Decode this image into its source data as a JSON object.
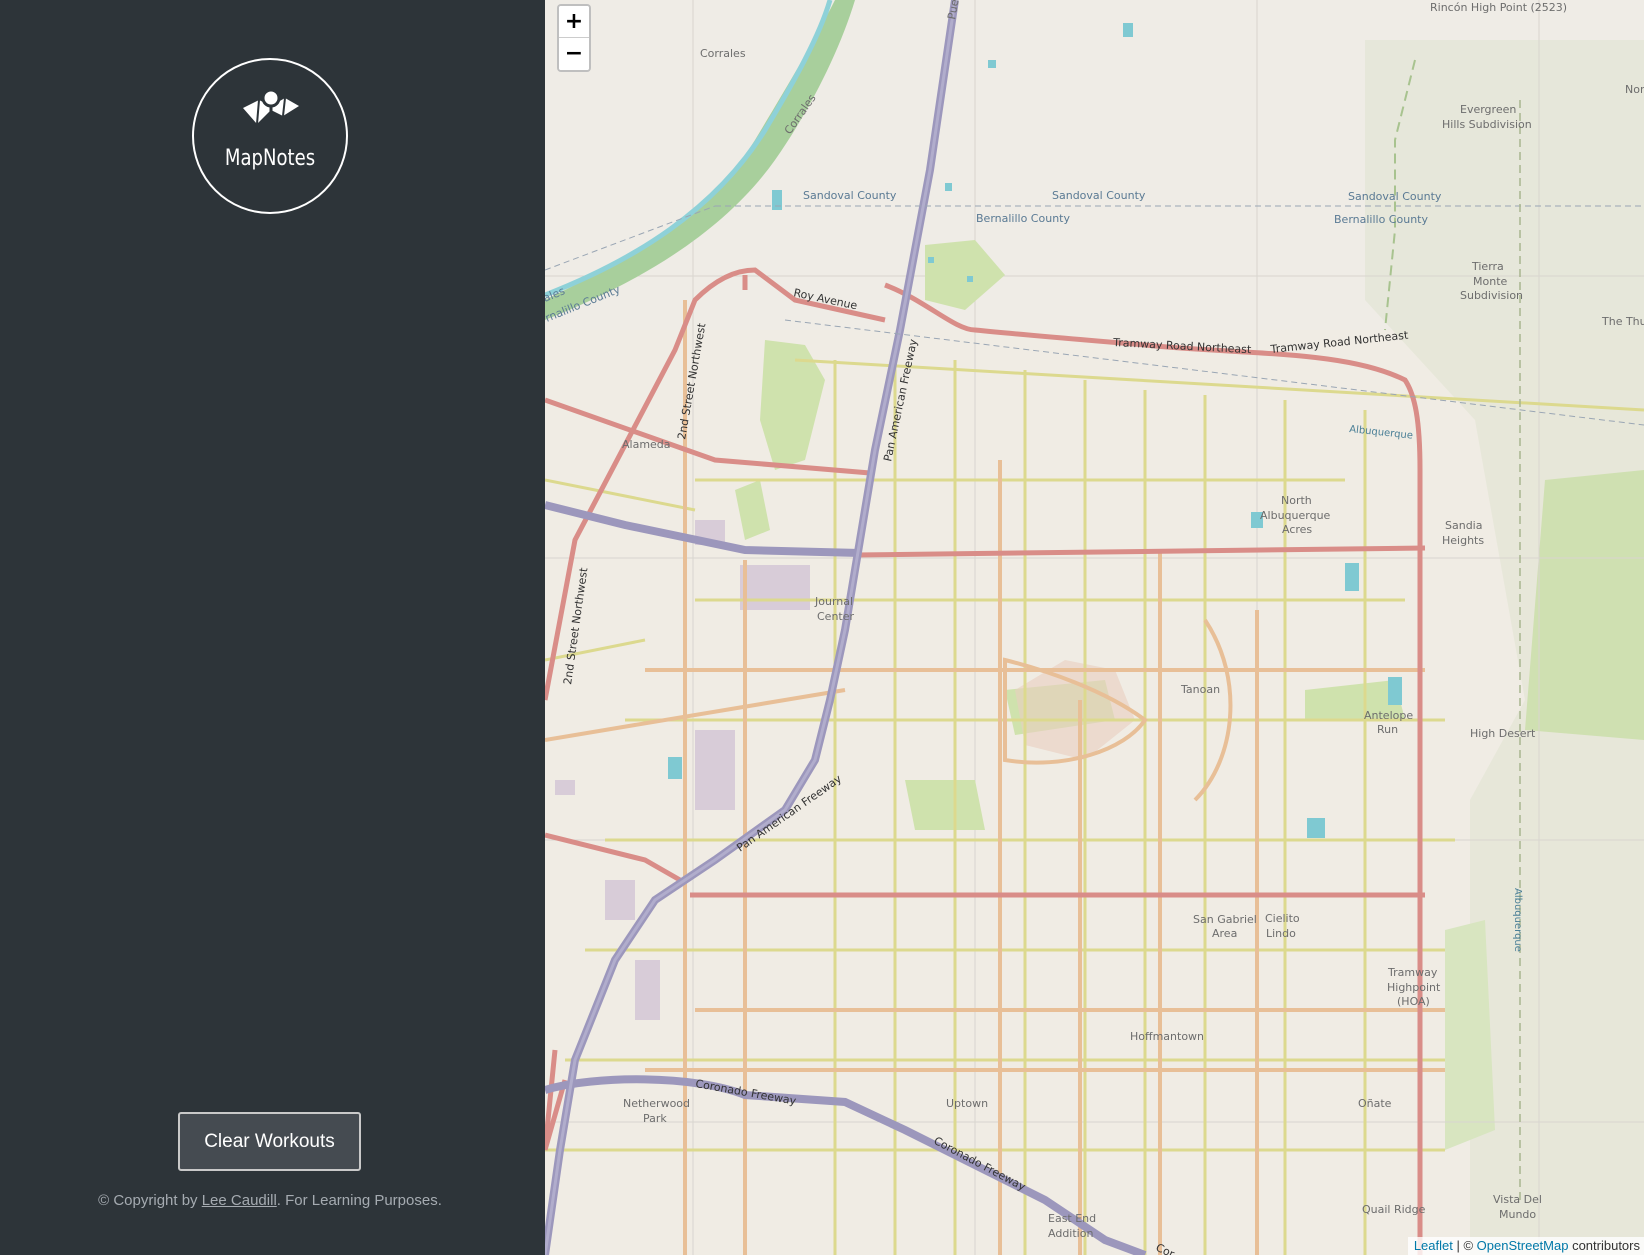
{
  "app": {
    "logo_text": "MapNotes",
    "logo_icon": "map-pin-icon"
  },
  "sidebar": {
    "clear_button_label": "Clear Workouts",
    "copyright_prefix": "© Copyright by ",
    "copyright_author": "Lee Caudill",
    "copyright_suffix": ". For Learning Purposes."
  },
  "map_controls": {
    "zoom_in": "+",
    "zoom_out": "−"
  },
  "attribution": {
    "leaflet": "Leaflet",
    "separator": " | © ",
    "osm": "OpenStreetMap",
    "suffix": " contributors"
  },
  "map_labels": {
    "corrales": "Corrales",
    "corrales_road": "Corrales",
    "sandoval_county": "Sandoval County",
    "bernalillo_county": "Bernalillo County",
    "bernalillo_county_left": "rnalillo County",
    "rincon": "Rincón High Point (2523)",
    "evergreen": [
      "Evergreen",
      "Hills Subdivision"
    ],
    "tierra": [
      "Tierra",
      "Monte",
      "Subdivision"
    ],
    "the_thu": "The Thu",
    "nort": "Nort",
    "roy_avenue": "Roy Avenue",
    "tramway_road": "Tramway Road Northeast",
    "second_street": "2nd Street Northwest",
    "alameda": "Alameda",
    "pan_american": "Pan American Freeway",
    "albuquerque": "Albuquerque",
    "north_albuquerque": [
      "North",
      "Albuquerque",
      "Acres"
    ],
    "sandia_heights": [
      "Sandia",
      "Heights"
    ],
    "journal_center": [
      "Journal",
      "Center"
    ],
    "tanoan": "Tanoan",
    "antelope_run": [
      "Antelope",
      "Run"
    ],
    "high_desert": "High Desert",
    "san_gabriel": [
      "San Gabriel",
      "Area"
    ],
    "cielito_lindo": [
      "Cielito",
      "Lindo"
    ],
    "tramway_highpoint": [
      "Tramway",
      "Highpoint",
      "(HOA)"
    ],
    "hoffmantown": "Hoffmantown",
    "coronado_freeway": "Coronado Freeway",
    "netherwood": [
      "Netherwood",
      "Park"
    ],
    "uptown": "Uptown",
    "onate": "Oñate",
    "quail_ridge": "Quail Ridge",
    "vista_del_mundo": [
      "Vista Del",
      "Mundo"
    ],
    "east_end": [
      "East End",
      "Addition"
    ],
    "pueblo": "Pueb",
    "coronado_short": "Cor",
    "ales": "ales"
  },
  "colors": {
    "sidebar_bg": "#2d3439",
    "map_bg": "#f2efe9",
    "freeway": "#9c97bc",
    "primary_road": "#d98d88",
    "secondary_road": "#e8bf97",
    "tertiary_road": "#d4d88a",
    "river": "#8fc19a",
    "water": "#7fc9d2",
    "park": "#c8dfa6"
  }
}
